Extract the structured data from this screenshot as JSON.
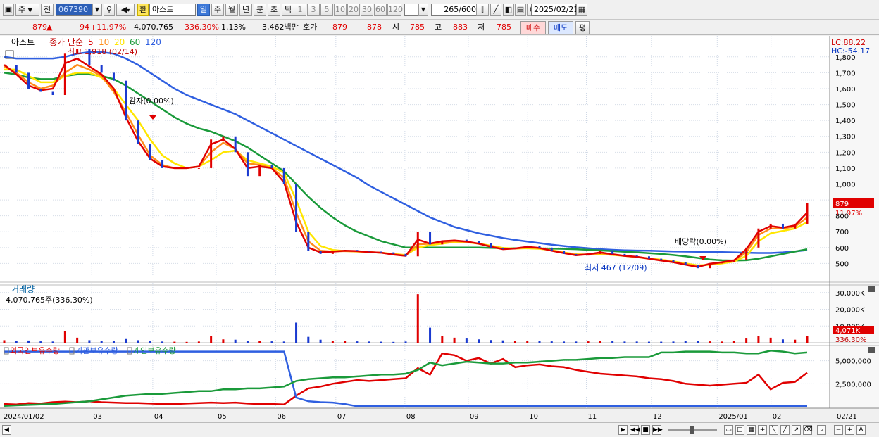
{
  "toolbar": {
    "market": "주",
    "prev_label": "전",
    "stock_code": "067390",
    "exchange_badge": "환",
    "stock_name": "아스트",
    "period_buttons": [
      "일",
      "주",
      "월",
      "년",
      "분",
      "초",
      "틱"
    ],
    "active_period": "일",
    "interval_buttons": [
      "1",
      "3",
      "5",
      "10",
      "20",
      "30",
      "60",
      "120"
    ],
    "count_value": "265",
    "count_total": "/600",
    "date_value": "2025/02/21"
  },
  "quote": {
    "price": "879",
    "arrow": "▲",
    "change": "94",
    "change_pct": "+11.97%",
    "volume": "4,070,765",
    "volume_ratio": "336.30%",
    "turnover": "1.13%",
    "trade_amount": "3,462백만",
    "bid_label": "호가",
    "ask_price": "879",
    "bid_price": "878",
    "open_label": "시",
    "open_value": "785",
    "high_label": "고",
    "high_value": "883",
    "low_label": "저",
    "low_value": "785",
    "buy_button": "매수",
    "sell_button": "매도",
    "eval_button": "평"
  },
  "chart_data": [
    {
      "type": "line",
      "panel": "price",
      "title": "아스트",
      "legend_prefix": "종가 단순",
      "ma_periods": [
        "5",
        "10",
        "20",
        "60",
        "120"
      ],
      "ma_colors": [
        "#e00000",
        "#ff8c1a",
        "#ffe600",
        "#1a9a3a",
        "#2f5fe0"
      ],
      "y_ticks": [
        500,
        600,
        700,
        800,
        900,
        1000,
        1100,
        1200,
        1300,
        1400,
        1500,
        1600,
        1700,
        1800
      ],
      "y_tick_labels": [
        "500",
        "600",
        "700",
        "800",
        "",
        "1,000",
        "1,100",
        "1,200",
        "1,300",
        "1,400",
        "1,500",
        "1,600",
        "1,700",
        "1,800"
      ],
      "ylim": [
        400,
        1870
      ],
      "x_labels": [
        "2024/01/02",
        "03",
        "04",
        "05",
        "06",
        "07",
        "08",
        "09",
        "10",
        "11",
        "12",
        "2025/01",
        "02",
        "02/21"
      ],
      "lc": "LC:88.22",
      "hc": "HC:-54.17",
      "current_price_label": "879",
      "current_pct_label": "11.97%",
      "annotations": [
        {
          "text": "최고 1,918 (02/14)",
          "color": "#c00000"
        },
        {
          "text": "감자(0.00%)",
          "color": "#000000"
        },
        {
          "text": "배당락(0.00%)",
          "color": "#000000"
        },
        {
          "text": "최저 467 (12/09)",
          "color": "#0030c0"
        }
      ],
      "close_series": [
        1750,
        1700,
        1600,
        1580,
        1560,
        1820,
        1850,
        1750,
        1700,
        1650,
        1400,
        1250,
        1150,
        1100,
        1100,
        1100,
        1100,
        1280,
        1300,
        1200,
        1050,
        1120,
        1100,
        1000,
        700,
        580,
        560,
        580,
        585,
        580,
        575,
        570,
        560,
        545,
        700,
        620,
        640,
        650,
        640,
        630,
        600,
        590,
        595,
        610,
        600,
        580,
        560,
        550,
        560,
        580,
        560,
        550,
        545,
        530,
        520,
        510,
        490,
        470,
        500,
        510,
        520,
        600,
        720,
        750,
        720,
        750,
        879
      ],
      "ma_series": [
        {
          "name": "5",
          "values": [
            1750,
            1690,
            1620,
            1590,
            1600,
            1760,
            1790,
            1740,
            1690,
            1600,
            1420,
            1270,
            1160,
            1110,
            1100,
            1100,
            1110,
            1250,
            1280,
            1220,
            1100,
            1110,
            1100,
            1010,
            760,
            600,
            570,
            575,
            580,
            578,
            572,
            568,
            556,
            548,
            650,
            625,
            640,
            645,
            638,
            625,
            605,
            590,
            595,
            605,
            598,
            580,
            565,
            552,
            558,
            570,
            558,
            548,
            542,
            530,
            518,
            508,
            492,
            478,
            498,
            508,
            520,
            590,
            700,
            735,
            725,
            740,
            820
          ]
        },
        {
          "name": "10",
          "values": [
            1740,
            1700,
            1640,
            1600,
            1620,
            1700,
            1750,
            1720,
            1680,
            1580,
            1450,
            1310,
            1180,
            1120,
            1100,
            1100,
            1110,
            1200,
            1260,
            1220,
            1130,
            1120,
            1100,
            1040,
            820,
            640,
            580,
            575,
            578,
            576,
            572,
            568,
            558,
            550,
            620,
            625,
            632,
            640,
            636,
            624,
            608,
            592,
            594,
            600,
            596,
            582,
            568,
            555,
            556,
            565,
            556,
            548,
            540,
            530,
            520,
            510,
            495,
            482,
            495,
            506,
            518,
            570,
            680,
            720,
            720,
            732,
            790
          ]
        },
        {
          "name": "20",
          "values": [
            1720,
            1720,
            1680,
            1640,
            1640,
            1680,
            1700,
            1700,
            1670,
            1600,
            1500,
            1400,
            1280,
            1180,
            1130,
            1100,
            1110,
            1150,
            1200,
            1210,
            1150,
            1130,
            1110,
            1070,
            900,
            700,
            610,
            585,
            578,
            575,
            572,
            568,
            560,
            553,
            600,
            615,
            625,
            635,
            634,
            625,
            612,
            598,
            594,
            596,
            592,
            584,
            570,
            558,
            556,
            560,
            554,
            548,
            540,
            532,
            524,
            514,
            500,
            488,
            492,
            500,
            512,
            548,
            640,
            690,
            705,
            720,
            760
          ]
        },
        {
          "name": "60",
          "values": [
            1700,
            1690,
            1670,
            1660,
            1660,
            1680,
            1690,
            1690,
            1680,
            1660,
            1620,
            1570,
            1520,
            1470,
            1420,
            1380,
            1350,
            1330,
            1300,
            1270,
            1230,
            1180,
            1130,
            1080,
            1000,
            920,
            850,
            790,
            740,
            700,
            670,
            640,
            620,
            600,
            600,
            600,
            600,
            600,
            600,
            600,
            598,
            596,
            596,
            596,
            595,
            594,
            592,
            590,
            586,
            582,
            578,
            574,
            570,
            565,
            560,
            553,
            545,
            535,
            525,
            520,
            518,
            520,
            530,
            545,
            560,
            575,
            590
          ]
        },
        {
          "name": "120",
          "values": [
            1800,
            1790,
            1790,
            1790,
            1790,
            1800,
            1820,
            1830,
            1830,
            1820,
            1790,
            1750,
            1700,
            1650,
            1600,
            1560,
            1530,
            1500,
            1470,
            1440,
            1400,
            1360,
            1320,
            1280,
            1240,
            1200,
            1160,
            1120,
            1080,
            1040,
            990,
            950,
            910,
            870,
            830,
            790,
            760,
            730,
            710,
            690,
            675,
            660,
            648,
            638,
            628,
            618,
            610,
            602,
            596,
            590,
            586,
            583,
            581,
            580,
            578,
            576,
            575,
            574,
            574,
            572,
            570,
            568,
            566,
            566,
            570,
            576,
            584
          ]
        }
      ]
    },
    {
      "type": "bar",
      "panel": "volume",
      "title": "거래량",
      "value_label": "4,070,765주(336.30%)",
      "y_ticks": [
        10000,
        20000,
        30000
      ],
      "y_tick_labels": [
        "10,000K",
        "20,000K",
        "30,000K"
      ],
      "ylim": [
        0,
        32000
      ],
      "current_label": "4,071K",
      "current_pct_label": "336.30%",
      "unit": "K shares",
      "values": [
        1500,
        900,
        1300,
        800,
        700,
        7000,
        3000,
        1500,
        1200,
        1000,
        2200,
        1500,
        900,
        700,
        600,
        500,
        700,
        4000,
        2000,
        1800,
        1200,
        900,
        800,
        700,
        12000,
        3500,
        1800,
        1200,
        900,
        800,
        700,
        600,
        500,
        700,
        29000,
        9000,
        4000,
        3000,
        2500,
        2000,
        1600,
        1400,
        1200,
        1000,
        900,
        800,
        700,
        700,
        800,
        1200,
        900,
        700,
        700,
        600,
        600,
        700,
        900,
        1000,
        800,
        700,
        900,
        2500,
        4000,
        3000,
        2000,
        1800,
        4071
      ]
    },
    {
      "type": "line",
      "panel": "holdings",
      "legend": [
        "외국인보유수량",
        "기관보유수량",
        "개인보유수량"
      ],
      "legend_colors": [
        "#e00000",
        "#2f5fe0",
        "#1a9a3a"
      ],
      "y_ticks": [
        2500000,
        5000000
      ],
      "y_tick_labels": [
        "2,500,000",
        "5,000,000"
      ],
      "ylim": [
        0,
        6200000
      ],
      "series": [
        {
          "name": "외국인보유수량",
          "values": [
            300000,
            250000,
            400000,
            350000,
            500000,
            550000,
            500000,
            600000,
            500000,
            450000,
            400000,
            400000,
            350000,
            300000,
            300000,
            350000,
            400000,
            450000,
            400000,
            450000,
            350000,
            300000,
            300000,
            250000,
            1200000,
            2000000,
            2200000,
            2500000,
            2700000,
            2900000,
            2800000,
            2900000,
            3000000,
            3100000,
            4200000,
            3500000,
            5800000,
            5600000,
            5000000,
            5300000,
            4700000,
            5200000,
            4300000,
            4500000,
            4600000,
            4400000,
            4300000,
            4000000,
            3800000,
            3600000,
            3500000,
            3400000,
            3300000,
            3100000,
            3000000,
            2800000,
            2500000,
            2400000,
            2300000,
            2400000,
            2500000,
            2600000,
            3500000,
            1900000,
            2600000,
            2700000,
            3700000
          ]
        },
        {
          "name": "기관보유수량",
          "values": [
            6000000,
            6000000,
            6000000,
            6000000,
            6000000,
            6000000,
            6000000,
            6000000,
            6000000,
            6000000,
            6000000,
            6000000,
            6000000,
            6000000,
            6000000,
            6000000,
            6000000,
            6000000,
            6000000,
            6000000,
            6000000,
            6000000,
            6000000,
            6000000,
            1000000,
            600000,
            500000,
            450000,
            300000,
            50000,
            50000,
            50000,
            50000,
            50000,
            50000,
            50000,
            50000,
            50000,
            50000,
            50000,
            50000,
            50000,
            50000,
            50000,
            50000,
            50000,
            50000,
            50000,
            50000,
            50000,
            50000,
            50000,
            50000,
            50000,
            50000,
            50000,
            50000,
            50000,
            50000,
            50000,
            50000,
            50000,
            50000,
            50000,
            50000,
            50000,
            50000
          ]
        },
        {
          "name": "개인보유수량",
          "values": [
            100000,
            150000,
            200000,
            250000,
            300000,
            400000,
            500000,
            600000,
            800000,
            1000000,
            1200000,
            1300000,
            1400000,
            1400000,
            1500000,
            1600000,
            1700000,
            1700000,
            1900000,
            1900000,
            2000000,
            2000000,
            2100000,
            2200000,
            2800000,
            3000000,
            3100000,
            3200000,
            3200000,
            3300000,
            3400000,
            3500000,
            3500000,
            3600000,
            4000000,
            4800000,
            4500000,
            4700000,
            4900000,
            4800000,
            4700000,
            4700000,
            4800000,
            4800000,
            4900000,
            5000000,
            5100000,
            5100000,
            5200000,
            5300000,
            5300000,
            5400000,
            5400000,
            5400000,
            5900000,
            5900000,
            6000000,
            6000000,
            6000000,
            5900000,
            5900000,
            5800000,
            5800000,
            6100000,
            6000000,
            5800000,
            5900000
          ]
        }
      ]
    }
  ]
}
